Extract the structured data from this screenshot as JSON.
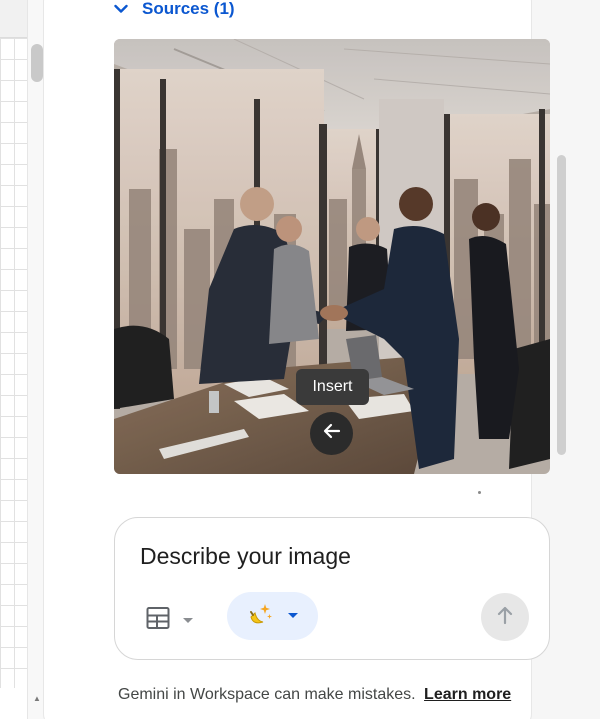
{
  "sources": {
    "label": "Sources (1)",
    "toggle_icon": "chevron-down-icon",
    "color": "#0b57d0"
  },
  "image": {
    "subject": "business handshake in a high-rise office meeting room"
  },
  "tooltip": {
    "label": "Insert"
  },
  "insert": {
    "icon": "arrow-left-icon"
  },
  "prompt": {
    "placeholder": "Describe your image",
    "layout_icon": "table-layout-icon",
    "style_icon": "banana-sparkle-icon",
    "send_icon": "arrow-up-icon"
  },
  "footer": {
    "disclaimer": "Gemini in Workspace can make mistakes.",
    "link": "Learn more"
  }
}
